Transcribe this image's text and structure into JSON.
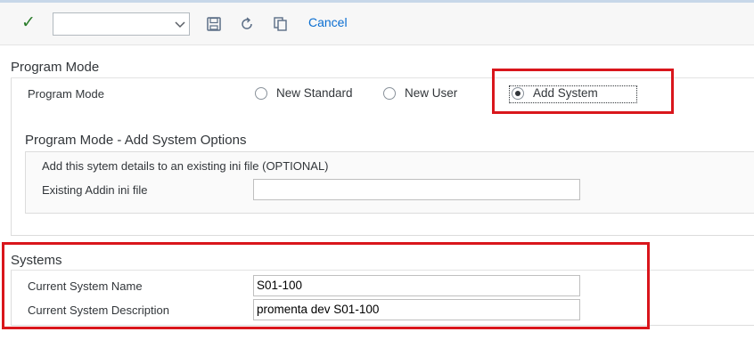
{
  "toolbar": {
    "combo_value": "",
    "cancel_label": "Cancel"
  },
  "program_mode": {
    "section_title": "Program Mode",
    "field_label": "Program Mode",
    "options": [
      {
        "label": "New Standard",
        "selected": false
      },
      {
        "label": "New User",
        "selected": false
      },
      {
        "label": "Add System",
        "selected": true
      }
    ]
  },
  "add_system_options": {
    "section_title": "Program Mode - Add System Options",
    "hint": "Add this sytem details to an existing ini file (OPTIONAL)",
    "ini_label": "Existing Addin ini file",
    "ini_value": ""
  },
  "systems": {
    "section_title": "Systems",
    "name_label": "Current System Name",
    "name_value": "S01-100",
    "desc_label": "Current System Description",
    "desc_value": "promenta dev S01-100"
  },
  "colors": {
    "highlight": "#d9161c",
    "link": "#0a6ed1",
    "confirm": "#2b7d2b"
  }
}
